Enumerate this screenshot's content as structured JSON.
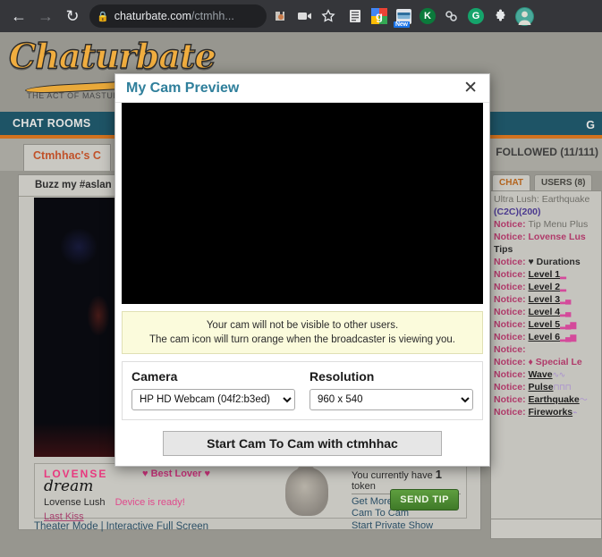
{
  "browser": {
    "back_icon": "back-arrow-icon",
    "forward_icon": "forward-arrow-icon",
    "reload_icon": "reload-icon",
    "lock_icon": "lock-icon",
    "url_domain": "chaturbate.com",
    "url_path": "/ctmhh...",
    "omnibox_icons": [
      "extension-puzzle-icon",
      "video-camera-icon",
      "bookmark-star-icon"
    ],
    "extension_icons": [
      "reading-list-icon",
      "google-icon",
      "new-badge-icon",
      "kaspersky-icon",
      "link-icon",
      "grammarly-icon",
      "extensions-puzzle-icon",
      "profile-avatar-icon"
    ],
    "new_badge_label": "New"
  },
  "site": {
    "logo_text": "Chaturbate",
    "logo_tagline": "THE ACT OF MASTUR",
    "nav": {
      "items": [
        "CHAT ROOMS"
      ],
      "right_item": "G"
    },
    "room_tab": "Ctmhhac's C",
    "followed": "FOLLOWED (11/111)",
    "topic": "Buzz my #aslan",
    "footer": {
      "theater_mode": "Theater Mode",
      "separator": "|",
      "interactive_full_screen": "Interactive Full Screen"
    }
  },
  "lovense": {
    "brand": "LOVENSE",
    "sub": "dream",
    "best_lover": "♥ Best Lover ♥",
    "device_label": "Lovense Lush",
    "device_status": "Device is ready!",
    "last_kiss": "Last Kiss"
  },
  "tips": {
    "tokens_line_prefix": "You currently have",
    "tokens_count": "1",
    "tokens_line_suffix": "token",
    "links": [
      "Get More Tokens",
      "Cam To Cam",
      "Start Private Show"
    ],
    "send_tip_label": "SEND TIP"
  },
  "chat": {
    "tabs": [
      {
        "label": "CHAT",
        "active": true
      },
      {
        "label": "USERS (8)",
        "active": false
      }
    ],
    "messages": [
      {
        "prefix": "",
        "text": "Ultra Lush: Earthquake",
        "style": "gray-clip"
      },
      {
        "prefix": "",
        "text": "(C2C)(200)",
        "style": "purple"
      },
      {
        "prefix": "Notice:",
        "text": "Tip Menu Plus",
        "style": "gray"
      },
      {
        "prefix": "Notice:",
        "text": "Lovense Lus",
        "style": "notice-bold"
      },
      {
        "prefix": "",
        "text": "Tips",
        "style": "dark"
      },
      {
        "prefix": "Notice:",
        "text": "♥ Durations",
        "style": "dark"
      },
      {
        "prefix": "Notice:",
        "text": "Level 1",
        "style": "level",
        "bars": 1
      },
      {
        "prefix": "Notice:",
        "text": "Level 2",
        "style": "level",
        "bars": 1
      },
      {
        "prefix": "Notice:",
        "text": "Level 3",
        "style": "level",
        "bars": 2
      },
      {
        "prefix": "Notice:",
        "text": "Level 4",
        "style": "level",
        "bars": 2
      },
      {
        "prefix": "Notice:",
        "text": "Level 5",
        "style": "level",
        "bars": 3
      },
      {
        "prefix": "Notice:",
        "text": "Level 6",
        "style": "level",
        "bars": 3
      },
      {
        "prefix": "Notice:",
        "text": "",
        "style": "level"
      },
      {
        "prefix": "Notice:",
        "text": "♦ Special Le",
        "style": "notice-bold"
      },
      {
        "prefix": "Notice:",
        "text": "Wave",
        "style": "level",
        "wave": "∿∿"
      },
      {
        "prefix": "Notice:",
        "text": "Pulse",
        "style": "level",
        "wave": "⊓⊓⊓"
      },
      {
        "prefix": "Notice:",
        "text": "Earthquake",
        "style": "level",
        "wave": "〜"
      },
      {
        "prefix": "Notice:",
        "text": "Fireworks",
        "style": "level",
        "wave": "⌁"
      }
    ]
  },
  "modal": {
    "title": "My Cam Preview",
    "close_icon": "close-x-icon",
    "warning_line1": "Your cam will not be visible to other users.",
    "warning_line2": "The cam icon will turn orange when the broadcaster is viewing you.",
    "camera_label": "Camera",
    "camera_value": "HP HD Webcam (04f2:b3ed)",
    "resolution_label": "Resolution",
    "resolution_value": "960 x 540",
    "start_button": "Start Cam To Cam with ctmhhac"
  },
  "colors": {
    "modal_title": "#2f7f9b",
    "nav_bg": "#1e5466",
    "nav_accent": "#d2721f",
    "logo": "#f0ad3f",
    "notice": "#b03a6a",
    "send_tip": "#4f8c33",
    "warning_bg": "#fbfbdc"
  }
}
